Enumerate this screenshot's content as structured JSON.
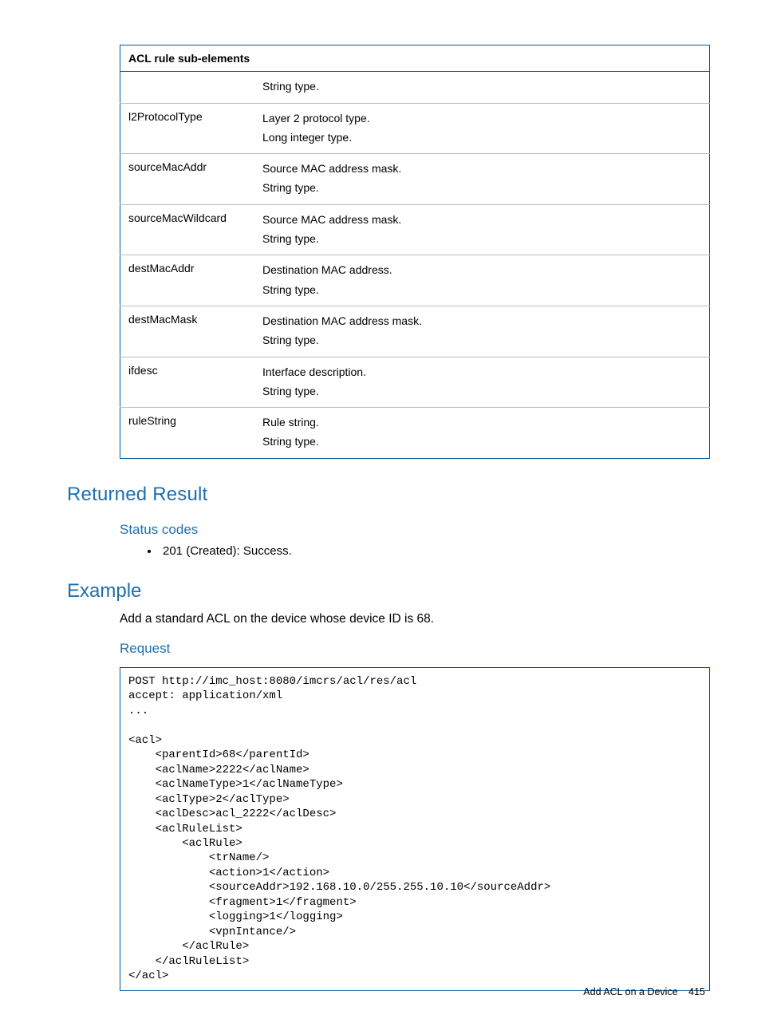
{
  "table": {
    "header": "ACL rule sub-elements",
    "rows": [
      {
        "name": "",
        "desc": [
          "String type."
        ]
      },
      {
        "name": "l2ProtocolType",
        "desc": [
          "Layer 2 protocol type.",
          "Long integer type."
        ]
      },
      {
        "name": "sourceMacAddr",
        "desc": [
          "Source MAC address mask.",
          "String type."
        ]
      },
      {
        "name": "sourceMacWildcard",
        "desc": [
          "Source MAC address mask.",
          "String type."
        ]
      },
      {
        "name": "destMacAddr",
        "desc": [
          "Destination MAC address.",
          "String type."
        ]
      },
      {
        "name": "destMacMask",
        "desc": [
          "Destination MAC address mask.",
          "String type."
        ]
      },
      {
        "name": "ifdesc",
        "desc": [
          "Interface description.",
          "String type."
        ]
      },
      {
        "name": "ruleString",
        "desc": [
          "Rule string.",
          "String type."
        ]
      }
    ]
  },
  "sections": {
    "returned_result": "Returned Result",
    "status_codes": "Status codes",
    "status_item": "201 (Created): Success.",
    "example": "Example",
    "example_body": "Add a standard ACL on the device whose device ID is 68.",
    "request": "Request"
  },
  "code": "POST http://imc_host:8080/imcrs/acl/res/acl\naccept: application/xml\n...\n\n<acl>\n    <parentId>68</parentId>\n    <aclName>2222</aclName>\n    <aclNameType>1</aclNameType>\n    <aclType>2</aclType>\n    <aclDesc>acl_2222</aclDesc>\n    <aclRuleList>\n        <aclRule>\n            <trName/>\n            <action>1</action>\n            <sourceAddr>192.168.10.0/255.255.10.10</sourceAddr>\n            <fragment>1</fragment>\n            <logging>1</logging>\n            <vpnIntance/>\n        </aclRule>\n    </aclRuleList>\n</acl>",
  "footer": {
    "title": "Add ACL on a Device",
    "page": "415"
  }
}
